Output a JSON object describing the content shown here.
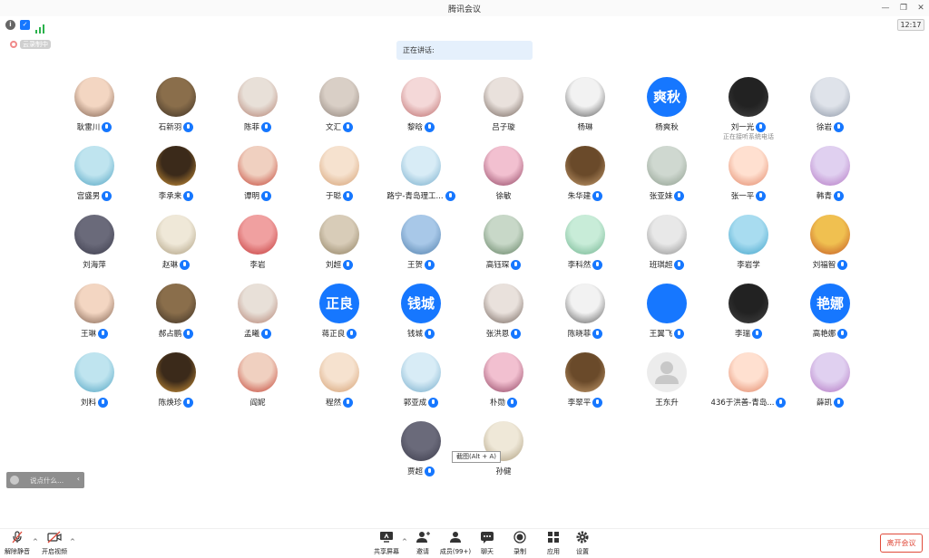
{
  "window": {
    "title": "腾讯会议"
  },
  "status": {
    "time": "12:17",
    "recording": "云录制中"
  },
  "speaking": {
    "label": "正在讲话:"
  },
  "participants": [
    {
      "name": "耿雷川",
      "mic": true
    },
    {
      "name": "石新羽",
      "mic": true
    },
    {
      "name": "陈菲",
      "mic": true
    },
    {
      "name": "文汇",
      "mic": true
    },
    {
      "name": "黎晗",
      "mic": true
    },
    {
      "name": "吕子璇",
      "mic": false
    },
    {
      "name": "杨琳",
      "mic": false
    },
    {
      "name": "杨爽秋",
      "mic": false,
      "avatar_text": "爽秋"
    },
    {
      "name": "刘一光",
      "mic": true,
      "sub": "正在接听系统电话"
    },
    {
      "name": "徐岩",
      "mic": true
    },
    {
      "name": "宫盛男",
      "mic": true
    },
    {
      "name": "李承来",
      "mic": true
    },
    {
      "name": "谭明",
      "mic": true
    },
    {
      "name": "于聪",
      "mic": true
    },
    {
      "name": "路宁-青岛理工...",
      "mic": true
    },
    {
      "name": "徐敏",
      "mic": false
    },
    {
      "name": "朱华建",
      "mic": true
    },
    {
      "name": "张亚妹",
      "mic": true
    },
    {
      "name": "张一平",
      "mic": true
    },
    {
      "name": "韩青",
      "mic": true
    },
    {
      "name": "刘海萍",
      "mic": false
    },
    {
      "name": "赵琳",
      "mic": true
    },
    {
      "name": "李岩",
      "mic": false
    },
    {
      "name": "刘超",
      "mic": true
    },
    {
      "name": "王贺",
      "mic": true
    },
    {
      "name": "高钰琛",
      "mic": true
    },
    {
      "name": "李科然",
      "mic": true
    },
    {
      "name": "班琪超",
      "mic": true
    },
    {
      "name": "李岩学",
      "mic": false
    },
    {
      "name": "刘福智",
      "mic": true
    },
    {
      "name": "王琳",
      "mic": true
    },
    {
      "name": "郝占鹏",
      "mic": true
    },
    {
      "name": "孟曦",
      "mic": true
    },
    {
      "name": "蒋正良",
      "mic": true,
      "avatar_text": "正良"
    },
    {
      "name": "钱城",
      "mic": true,
      "avatar_text": "钱城"
    },
    {
      "name": "张洪恩",
      "mic": true
    },
    {
      "name": "陈晓菲",
      "mic": true
    },
    {
      "name": "王翼飞",
      "mic": true
    },
    {
      "name": "李瑞",
      "mic": true
    },
    {
      "name": "高艳娜",
      "mic": true,
      "avatar_text": "艳娜"
    },
    {
      "name": "刘科",
      "mic": true
    },
    {
      "name": "陈焕珍",
      "mic": true
    },
    {
      "name": "阎妮",
      "mic": false
    },
    {
      "name": "程然",
      "mic": true
    },
    {
      "name": "郭亚成",
      "mic": true
    },
    {
      "name": "朴勋",
      "mic": true
    },
    {
      "name": "李翠平",
      "mic": true
    },
    {
      "name": "王东升",
      "mic": false
    },
    {
      "name": "436于洪善-青岛...",
      "mic": true
    },
    {
      "name": "薛凯",
      "mic": true
    },
    {
      "name": "贾超",
      "mic": true
    },
    {
      "name": "孙健",
      "mic": false
    }
  ],
  "tooltip": {
    "text": "截图(Alt + A)"
  },
  "chat_mini": {
    "placeholder": "说点什么..."
  },
  "toolbar": {
    "unmute": "解除静音",
    "start_video": "开启视频",
    "share_screen": "共享屏幕",
    "invite": "邀请",
    "members": "成员(99+)",
    "chat": "聊天",
    "record": "录制",
    "apps": "应用",
    "settings": "设置",
    "leave": "离开会议"
  },
  "colors": {
    "accent": "#1677ff",
    "leave": "#e04a3a"
  }
}
